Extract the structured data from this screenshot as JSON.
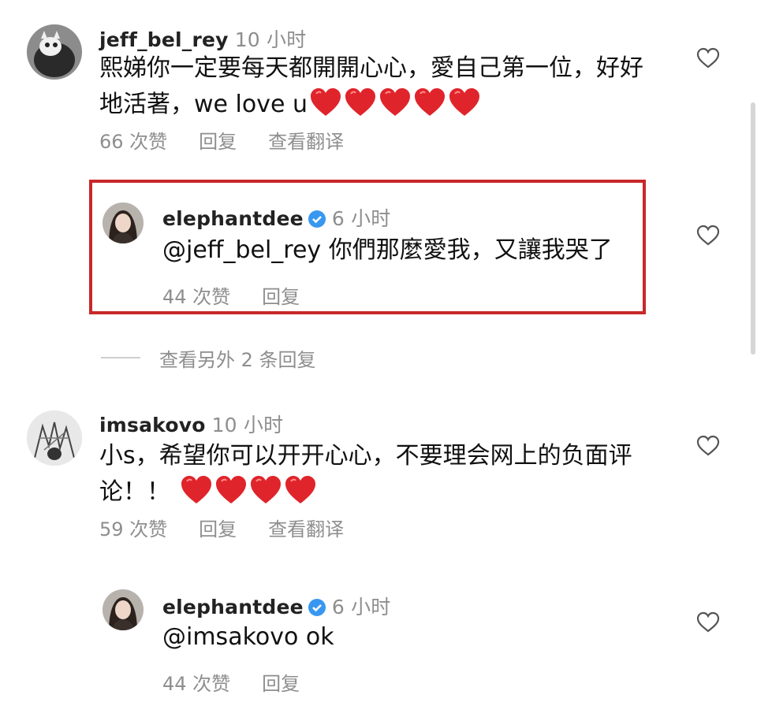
{
  "comments": [
    {
      "username": "jeff_bel_rey",
      "time": "10 小时",
      "line1": "熙娣你一定要每天都開開心心，愛自己第一位，好好",
      "line2": "地活著，we love u",
      "likes": "66 次赞",
      "reply": "回复",
      "translate": "查看翻译",
      "hearts": 5,
      "avatar_icon": "cat-avatar-icon"
    },
    {
      "username": "elephantdee",
      "time": "6 小时",
      "verified": true,
      "line1": "@jeff_bel_rey 你們那麼愛我，又讓我哭了",
      "likes": "44 次赞",
      "reply": "回复",
      "highlight_color": "#c8282a",
      "avatar_icon": "woman-avatar-icon"
    },
    {
      "more_replies": "查看另外 2 条回复"
    },
    {
      "username": "imsakovo",
      "time": "10 小时",
      "line1": "小s，希望你可以开开心心，不要理会网上的负面评",
      "line2": "论！！",
      "likes": "59 次赞",
      "reply": "回复",
      "translate": "查看翻译",
      "hearts": 4,
      "avatar_icon": "sketch-avatar-icon"
    },
    {
      "username": "elephantdee",
      "time": "6 小时",
      "verified": true,
      "line1": "@imsakovo ok",
      "likes": "44 次赞",
      "reply": "回复",
      "avatar_icon": "woman-avatar-icon"
    }
  ],
  "colors": {
    "meta": "#8e8e8e",
    "verified": "#3897f0",
    "heart": "#e0242b"
  }
}
